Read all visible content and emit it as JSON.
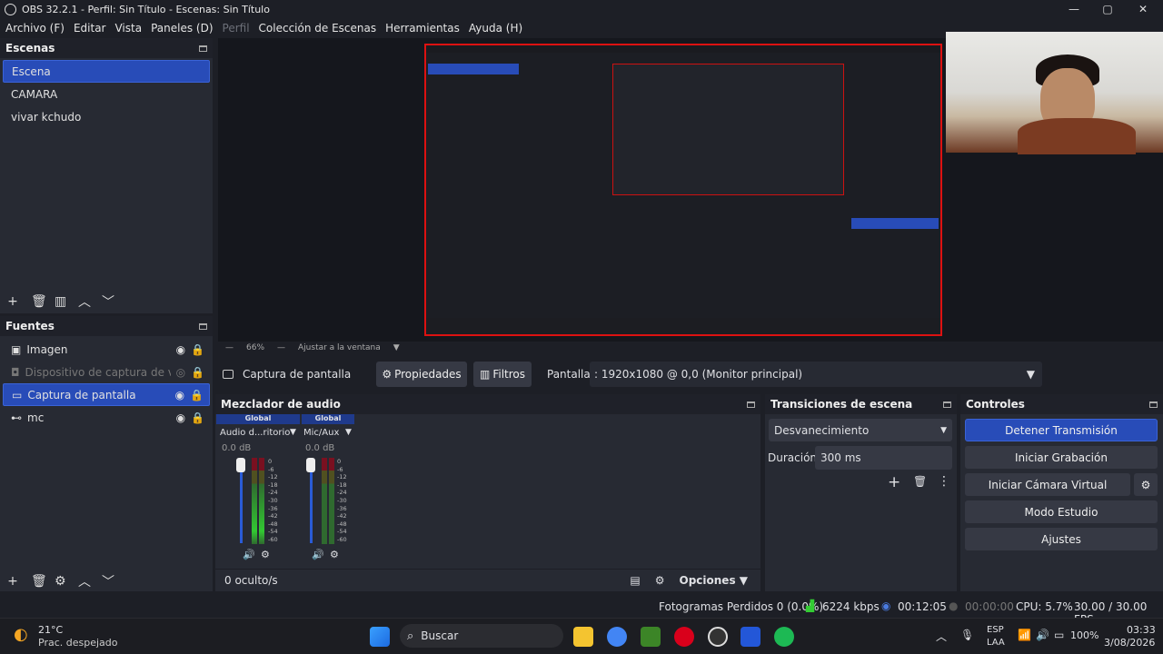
{
  "window": {
    "title": "OBS 32.2.1 - Perfil: Sin Título - Escenas: Sin Título",
    "min": "—",
    "max": "▢",
    "close": "✕"
  },
  "menu": [
    "Archivo (F)",
    "Editar",
    "Vista",
    "Paneles (D)",
    "Perfil",
    "Colección de Escenas",
    "Herramientas",
    "Ayuda (H)"
  ],
  "scenes": {
    "title": "Escenas",
    "items": [
      "Escena",
      "CAMARA",
      "vivar kchudo"
    ]
  },
  "sources": {
    "title": "Fuentes",
    "items": [
      "Imagen",
      "Dispositivo de captura de video",
      "Captura de pantalla",
      "mc"
    ]
  },
  "zoom": {
    "level": "66%",
    "fit": "Ajustar a la ventana"
  },
  "sourcebar": {
    "name": "Captura de pantalla",
    "props": "Propiedades",
    "filters": "Filtros",
    "screen_label": "Pantalla",
    "screen_value": ": 1920x1080 @ 0,0 (Monitor principal)"
  },
  "mixer": {
    "title": "Mezclador de audio",
    "channels": [
      {
        "tag": "Global",
        "name": "Audio d...ritorio",
        "db": "0.0 dB"
      },
      {
        "tag": "Global",
        "name": "Mic/Aux",
        "db": "0.0 dB"
      }
    ],
    "scale": [
      "0",
      "-6",
      "-12",
      "-18",
      "-24",
      "-30",
      "-36",
      "-42",
      "-48",
      "-54",
      "-60"
    ],
    "hidden": "0 oculto/s",
    "options": "Opciones"
  },
  "transitions": {
    "title": "Transiciones de escena",
    "type": "Desvanecimiento",
    "dur_label": "Duración",
    "dur_value": "300 ms"
  },
  "controls": {
    "title": "Controles",
    "stop": "Detener Transmisión",
    "rec": "Iniciar Grabación",
    "vcam": "Iniciar Cámara Virtual",
    "studio": "Modo Estudio",
    "settings": "Ajustes"
  },
  "status": {
    "dropped": "Fotogramas Perdidos 0 (0.0%)",
    "kbps": "6224 kbps",
    "live": "00:12:05",
    "rec": "00:00:00",
    "cpu": "CPU: 5.7%",
    "fps": "30.00 / 30.00 FPS"
  },
  "taskbar": {
    "temp": "21°C",
    "weather": "Prac. despejado",
    "search": "Buscar",
    "lang1": "ESP",
    "lang2": "LAA",
    "battery": "100%",
    "time": "03:33",
    "date": "3/08/2026"
  }
}
